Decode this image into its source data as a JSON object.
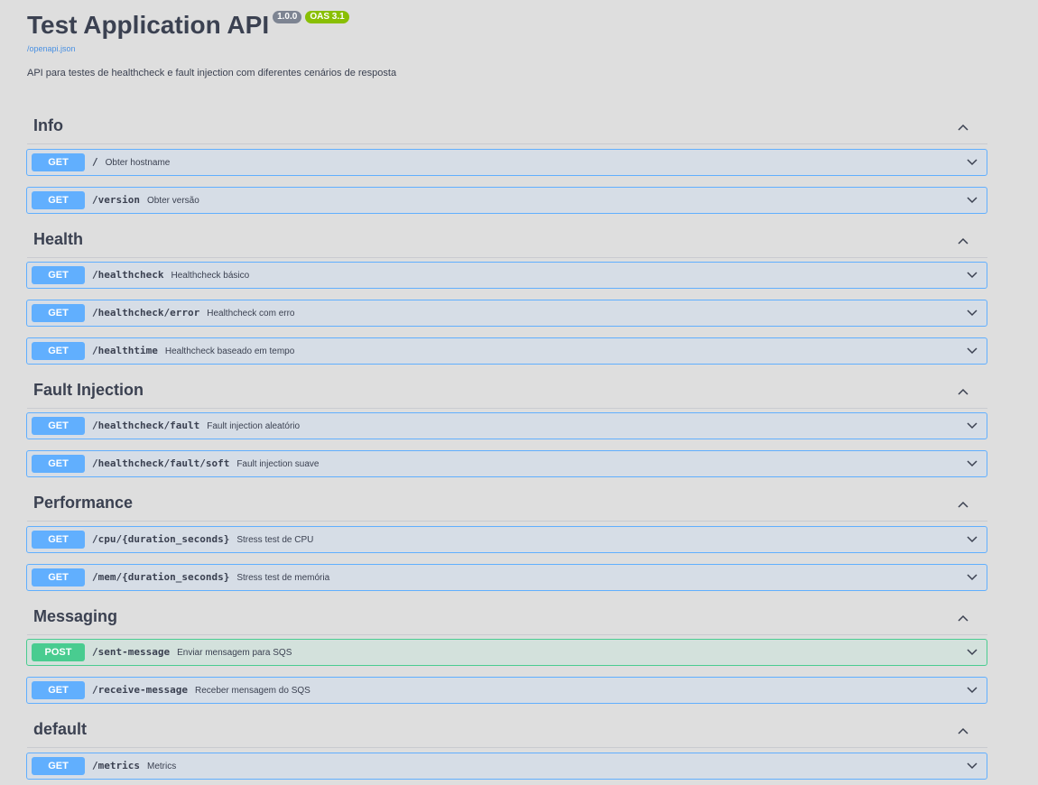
{
  "info": {
    "title": "Test Application API",
    "version_badge": "1.0.0",
    "oas_badge": "OAS 3.1",
    "spec_link": "/openapi.json",
    "description": "API para testes de healthcheck e fault injection com diferentes cenários de resposta"
  },
  "icons": {
    "section_toggle": "chevron-up-icon",
    "operation_toggle": "chevron-down-icon"
  },
  "colors": {
    "get": "#61affe",
    "post": "#49cc90",
    "oas": "#89bf04",
    "version": "#7d8492"
  },
  "sections": [
    {
      "name": "Info",
      "operations": [
        {
          "method": "GET",
          "path": "/",
          "summary": "Obter hostname"
        },
        {
          "method": "GET",
          "path": "/version",
          "summary": "Obter versão"
        }
      ]
    },
    {
      "name": "Health",
      "operations": [
        {
          "method": "GET",
          "path": "/healthcheck",
          "summary": "Healthcheck básico"
        },
        {
          "method": "GET",
          "path": "/healthcheck/error",
          "summary": "Healthcheck com erro"
        },
        {
          "method": "GET",
          "path": "/healthtime",
          "summary": "Healthcheck baseado em tempo"
        }
      ]
    },
    {
      "name": "Fault Injection",
      "operations": [
        {
          "method": "GET",
          "path": "/healthcheck/fault",
          "summary": "Fault injection aleatório"
        },
        {
          "method": "GET",
          "path": "/healthcheck/fault/soft",
          "summary": "Fault injection suave"
        }
      ]
    },
    {
      "name": "Performance",
      "operations": [
        {
          "method": "GET",
          "path": "/cpu/{duration_seconds}",
          "summary": "Stress test de CPU"
        },
        {
          "method": "GET",
          "path": "/mem/{duration_seconds}",
          "summary": "Stress test de memória"
        }
      ]
    },
    {
      "name": "Messaging",
      "operations": [
        {
          "method": "POST",
          "path": "/sent-message",
          "summary": "Enviar mensagem para SQS"
        },
        {
          "method": "GET",
          "path": "/receive-message",
          "summary": "Receber mensagem do SQS"
        }
      ]
    },
    {
      "name": "default",
      "operations": [
        {
          "method": "GET",
          "path": "/metrics",
          "summary": "Metrics"
        }
      ]
    }
  ]
}
